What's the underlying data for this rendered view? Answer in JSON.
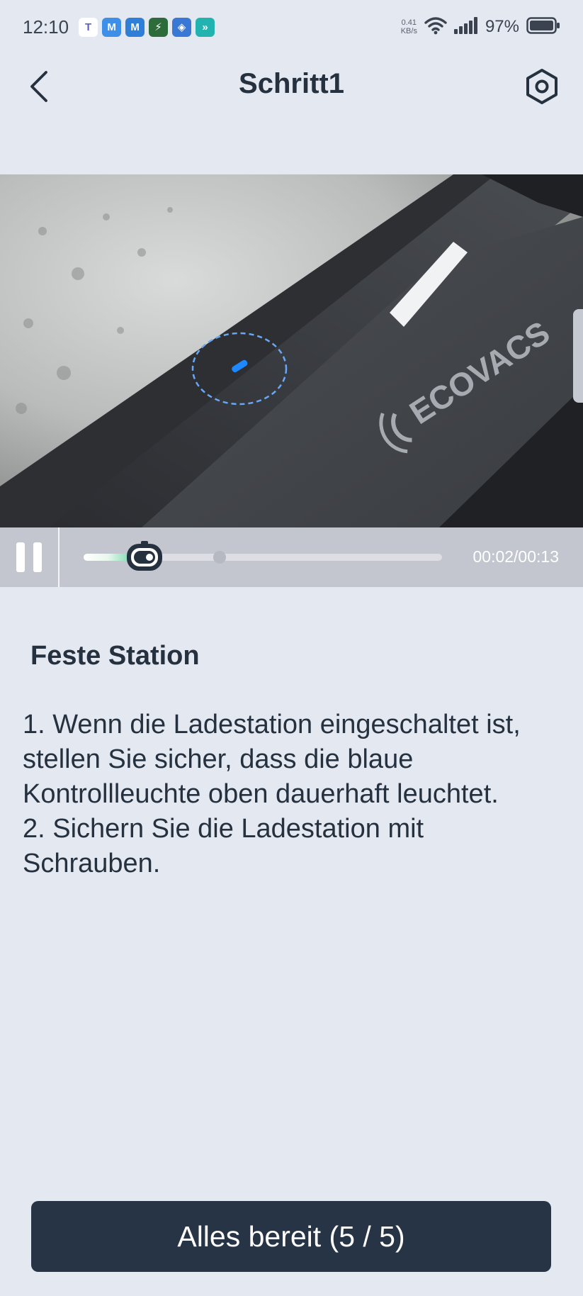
{
  "status_bar": {
    "time": "12:10",
    "net_speed_value": "0.41",
    "net_speed_unit": "KB/s",
    "battery_percent": "97%",
    "notification_icons": [
      "teams-icon",
      "mail-icon",
      "mail-alt-icon",
      "battery-saver-icon",
      "shield-icon",
      "link-icon"
    ]
  },
  "header": {
    "title": "Schritt1",
    "back_icon": "chevron-left-icon",
    "settings_icon": "hex-nut-settings-icon"
  },
  "video": {
    "current_time": "00:02",
    "duration": "00:13",
    "time_display": "00:02/00:13",
    "progress_fraction": 0.17,
    "buffer_fraction": 0.38,
    "logo_text": "ECOVACS"
  },
  "content": {
    "section_title": "Feste Station",
    "instruction_1": "1. Wenn die Ladestation eingeschaltet ist, stellen Sie sicher, dass die blaue Kontrollleuchte oben dauerhaft leuchtet.",
    "instruction_2": "2. Sichern Sie die Ladestation mit Schrauben."
  },
  "footer": {
    "button_label": "Alles bereit (5 / 5)"
  },
  "colors": {
    "background": "#e4e8f1",
    "primary_button": "#263445",
    "text": "#26313f",
    "progress_accent": "#3fcb8e",
    "indicator_light": "#1e88ff"
  }
}
